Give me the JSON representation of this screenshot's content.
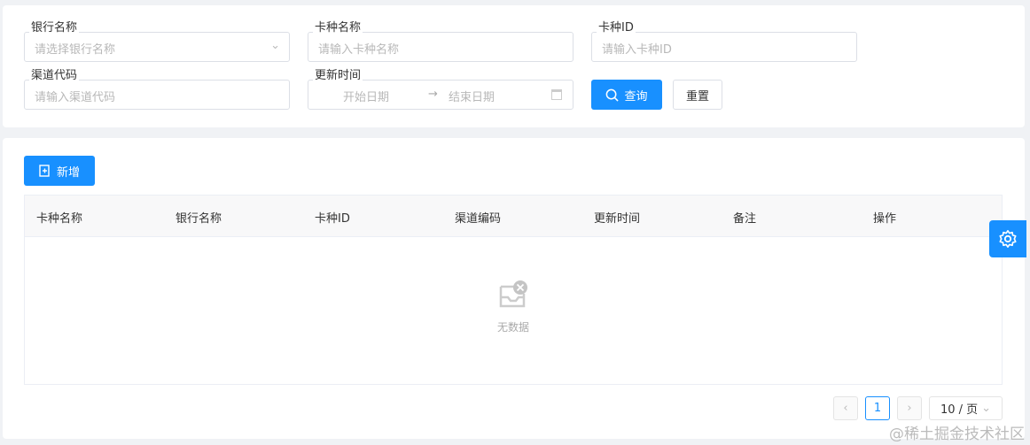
{
  "search": {
    "bank_name": {
      "label": "银行名称",
      "placeholder": "请选择银行名称"
    },
    "card_name": {
      "label": "卡种名称",
      "placeholder": "请输入卡种名称"
    },
    "card_id": {
      "label": "卡种ID",
      "placeholder": "请输入卡种ID"
    },
    "channel_code": {
      "label": "渠道代码",
      "placeholder": "请输入渠道代码"
    },
    "update_time": {
      "label": "更新时间",
      "start_placeholder": "开始日期",
      "end_placeholder": "结束日期",
      "separator": "→"
    },
    "query_label": "查询",
    "reset_label": "重置"
  },
  "toolbar": {
    "add_label": "新增"
  },
  "table": {
    "columns": [
      "卡种名称",
      "银行名称",
      "卡种ID",
      "渠道编码",
      "更新时间",
      "备注",
      "操作"
    ],
    "rows": [],
    "empty_text": "无数据"
  },
  "pagination": {
    "current_page": "1",
    "page_size": "10 / 页",
    "prev": "‹",
    "next": "›"
  },
  "watermark": "@稀土掘金技术社区",
  "colors": {
    "primary": "#1890ff"
  }
}
